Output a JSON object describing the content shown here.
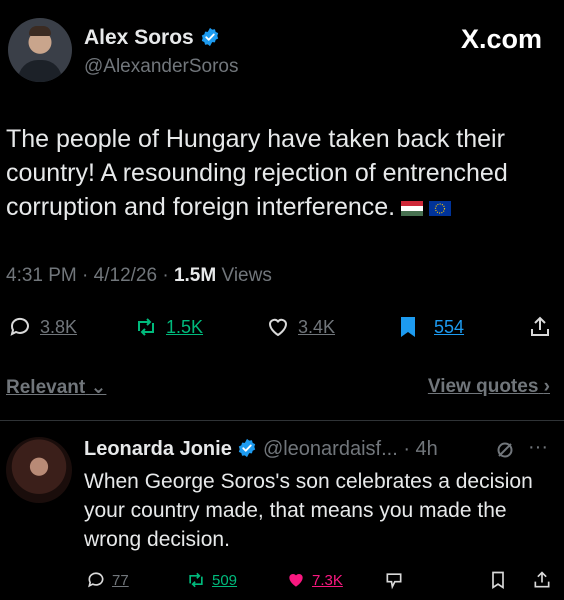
{
  "tweet": {
    "author_name": "Alex Soros",
    "author_handle": "@AlexanderSoros",
    "platform_label": "X.com",
    "text": "The people of Hungary have taken back their country! A resounding rejection of entrenched corruption and foreign interference.",
    "time": "4:31 PM",
    "date": "4/12/26",
    "views_count": "1.5M",
    "views_label": "Views",
    "replies": "3.8K",
    "reposts": "1.5K",
    "likes": "3.4K",
    "bookmarks": "554"
  },
  "sort": {
    "relevant_label": "Relevant",
    "view_quotes_label": "View quotes"
  },
  "reply": {
    "author_name": "Leonarda Jonie",
    "author_handle": "@leonardaisf...",
    "age": "4h",
    "text": "When George Soros's son celebrates a decision your country made, that means you made the wrong decision.",
    "replies": "77",
    "reposts": "509",
    "likes": "7.3K"
  },
  "colors": {
    "background": "#000000",
    "verified": "#1d9bf0",
    "repost_green": "#00ba7c",
    "like_pink": "#f91880",
    "bookmark_blue": "#1d9bf0",
    "muted": "#71767b"
  },
  "icons": [
    "reply-icon",
    "repost-icon",
    "like-icon",
    "bookmark-icon",
    "share-icon",
    "verified-icon",
    "chevron-down-icon",
    "chevron-right-icon",
    "grok-icon",
    "more-icon",
    "analytics-icon",
    "hungary-flag-icon",
    "eu-flag-icon"
  ]
}
